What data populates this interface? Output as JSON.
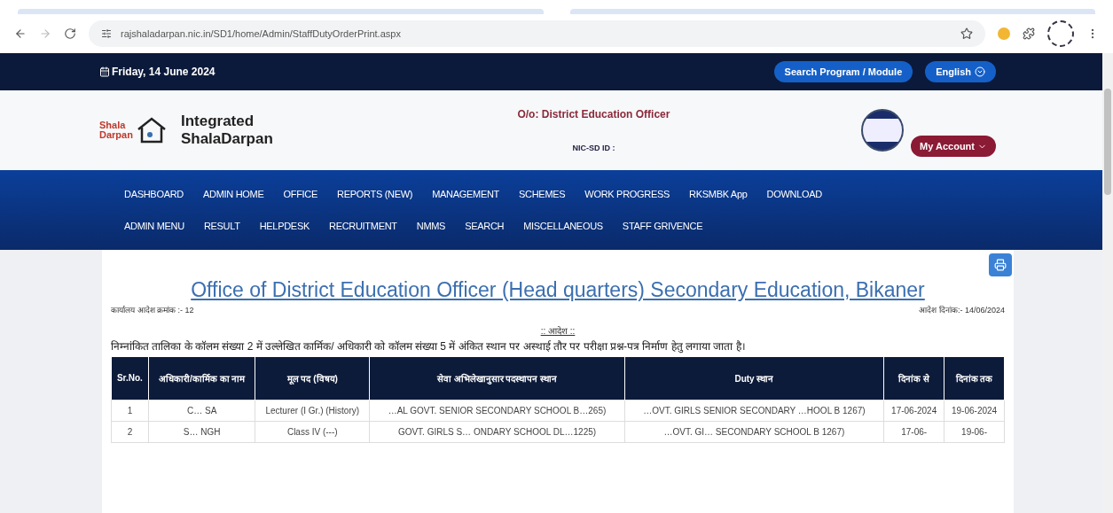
{
  "browser": {
    "url": "rajshaladarpan.nic.in/SD1/home/Admin/StaffDutyOrderPrint.aspx"
  },
  "topbar": {
    "date": "Friday, 14 June 2024",
    "search_button": "Search Program / Module",
    "language_button": "English"
  },
  "header": {
    "logo_text": [
      "Shala",
      "Darpan"
    ],
    "title_lines": [
      "Integrated",
      "ShalaDarpan"
    ],
    "office": "O/o: District Education Officer",
    "nic_label": "NIC-SD ID :",
    "account_button": "My Account"
  },
  "nav": {
    "items": [
      "DASHBOARD",
      "ADMIN HOME",
      "OFFICE",
      "REPORTS (NEW)",
      "MANAGEMENT",
      "SCHEMES",
      "WORK PROGRESS",
      "RKSMBK App",
      "DOWNLOAD",
      "ADMIN MENU",
      "RESULT",
      "HELPDESK",
      "RECRUITMENT",
      "NMMS",
      "SEARCH",
      "MISCELLANEOUS",
      "STAFF GRIVENCE"
    ]
  },
  "document": {
    "heading": "Office of District Education Officer (Head quarters) Secondary Education, Bikaner",
    "order_no": "कार्यालय आदेश क्रमांक :-  12",
    "order_date": "आदेश दिनांक:-  14/06/2024",
    "order_title": ":: आदेश ::",
    "body": "निम्नांकित तालिका के कॉलम संख्या 2 में उल्लेखित कार्मिक/ अधिकारी को कॉलम संख्या 5 में अंकित स्थान पर अस्थाई तौर पर परीक्षा प्रश्न-पत्र निर्माण हेतु लगाया जाता है।",
    "table": {
      "columns": [
        "Sr.No.",
        "अधिकारी/कार्मिक का नाम",
        "मूल पद (विषय)",
        "सेवा अभिलेखानुसार पदस्थापन स्थान",
        "Duty स्थान",
        "दिनांक से",
        "दिनांक तक"
      ],
      "rows": [
        [
          "1",
          "C…  SA",
          "Lecturer (I Gr.) (History)",
          "…AL GOVT. SENIOR SECONDARY SCHOOL B…265)",
          "…OVT. GIRLS SENIOR SECONDARY …HOOL B 1267)",
          "17-06-2024",
          "19-06-2024"
        ],
        [
          "2",
          "S…  NGH",
          "Class IV (---)",
          "GOVT. GIRLS S… ONDARY SCHOOL DL…1225)",
          "…OVT. GI… SECONDARY SCHOOL B 1267)",
          "17-06-",
          "19-06-"
        ]
      ]
    }
  }
}
